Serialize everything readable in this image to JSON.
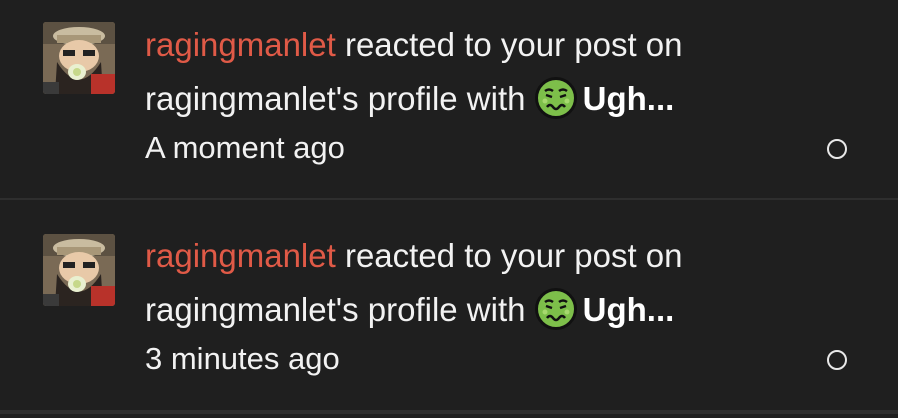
{
  "notifications": [
    {
      "username": "ragingmanlet",
      "action_text": " reacted to your post on ragingmanlet's profile with ",
      "reaction_icon": "nauseated-face-icon",
      "reaction_label": "Ugh...",
      "timestamp": "A moment ago",
      "status": "unread"
    },
    {
      "username": "ragingmanlet",
      "action_text": " reacted to your post on ragingmanlet's profile with ",
      "reaction_icon": "nauseated-face-icon",
      "reaction_label": "Ugh...",
      "timestamp": "3 minutes ago",
      "status": "unread"
    }
  ],
  "colors": {
    "background": "#1f1f1f",
    "username": "#e05a47",
    "text": "#f2f2f2",
    "divider": "#2e2e2e"
  }
}
